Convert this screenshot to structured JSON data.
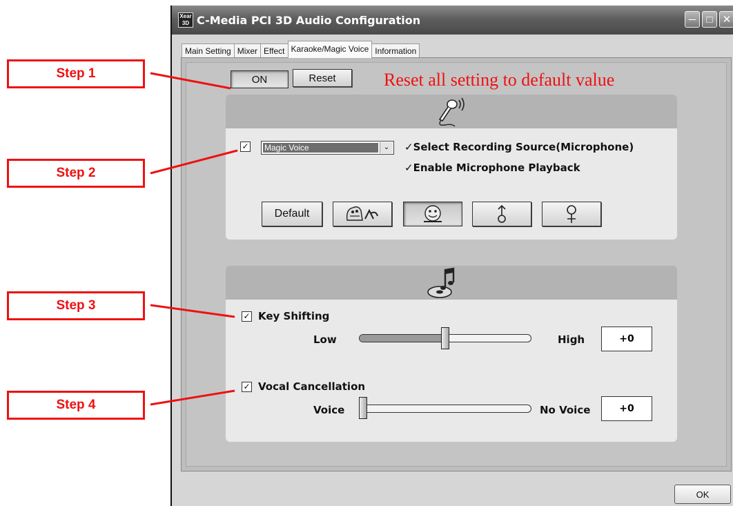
{
  "window": {
    "title": "C-Media PCI 3D Audio Configuration",
    "icon_text": "Xear 3D",
    "controls": [
      "minimize",
      "maximize",
      "close"
    ]
  },
  "tabs": [
    {
      "label": "Main Setting",
      "active": false
    },
    {
      "label": "Mixer",
      "active": false
    },
    {
      "label": "Effect",
      "active": false
    },
    {
      "label": "Karaoke/Magic Voice",
      "active": true
    },
    {
      "label": "Information",
      "active": false
    }
  ],
  "karaoke": {
    "on_label": "ON",
    "reset_label": "Reset",
    "reset_note": "Reset all setting to default value",
    "voice_panel": {
      "icon": "microphone-icon",
      "magic_voice_checked": true,
      "select_value": "Magic Voice",
      "select_recording": "✓Select Recording Source(Microphone)",
      "enable_playback": "✓Enable Microphone Playback",
      "buttons": [
        {
          "label": "Default",
          "icon": ""
        },
        {
          "label": "",
          "icon": "monster-voice-icon"
        },
        {
          "label": "",
          "icon": "cartoon-voice-icon"
        },
        {
          "label": "",
          "icon": "male-voice-icon"
        },
        {
          "label": "",
          "icon": "female-voice-icon"
        }
      ]
    },
    "music_panel": {
      "icon": "music-disc-icon",
      "key_shifting": {
        "label": "Key Shifting",
        "checked": true,
        "low": "Low",
        "high": "High",
        "value": "+0",
        "position": 0.5
      },
      "vocal_cancellation": {
        "label": "Vocal Cancellation",
        "checked": true,
        "low": "Voice",
        "high": "No Voice",
        "value": "+0",
        "position": 0.0
      }
    }
  },
  "footer": {
    "ok_label": "OK"
  },
  "steps": [
    "Step 1",
    "Step 2",
    "Step 3",
    "Step 4"
  ],
  "colors": {
    "callout": "#ee1111",
    "title_bar": "#5e5e5e"
  }
}
